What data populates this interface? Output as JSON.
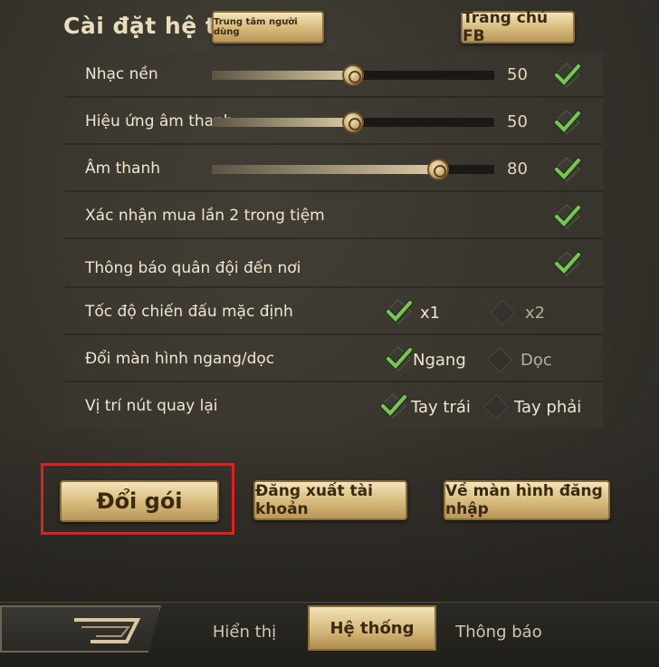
{
  "header": {
    "title": "Cài đặt hệ thống",
    "user_center_label": "Trung tâm người dùng",
    "fb_home_label": "Trang chủ FB"
  },
  "settings": {
    "music": {
      "label": "Nhạc nền",
      "value": "50",
      "level": 0.5,
      "checked": true
    },
    "sfx": {
      "label": "Hiệu ứng âm thanh",
      "value": "50",
      "level": 0.5,
      "checked": true
    },
    "sound": {
      "label": "Âm thanh",
      "value": "80",
      "level": 0.8,
      "checked": true
    },
    "confirm_buy": {
      "label": "Xác nhận mua lần 2 trong tiệm",
      "checked": true
    },
    "army_arrival": {
      "label": "Thông báo quân đội đến nơi",
      "checked": true
    },
    "battle_speed": {
      "label": "Tốc độ chiến đấu mặc định",
      "options": [
        "x1",
        "x2"
      ],
      "selected": "x1"
    },
    "orientation": {
      "label": "Đổi màn hình ngang/dọc",
      "options": [
        "Ngang",
        "Dọc"
      ],
      "selected": "Ngang"
    },
    "back_button_pos": {
      "label": "Vị trí nút quay lại",
      "options": [
        "Tay trái",
        "Tay phải"
      ],
      "selected": "Tay trái"
    }
  },
  "actions": {
    "switch_package": "Đổi gói",
    "logout": "Đăng xuất tài khoản",
    "back_to_login": "Về màn hình đăng nhập"
  },
  "tabs": {
    "display": "Hiển thị",
    "system": "Hệ thống",
    "notice": "Thông báo",
    "active": "system"
  },
  "colors": {
    "gold": "#d6b97a",
    "check_green": "#4f8a3a",
    "highlight_red": "#e02020"
  }
}
